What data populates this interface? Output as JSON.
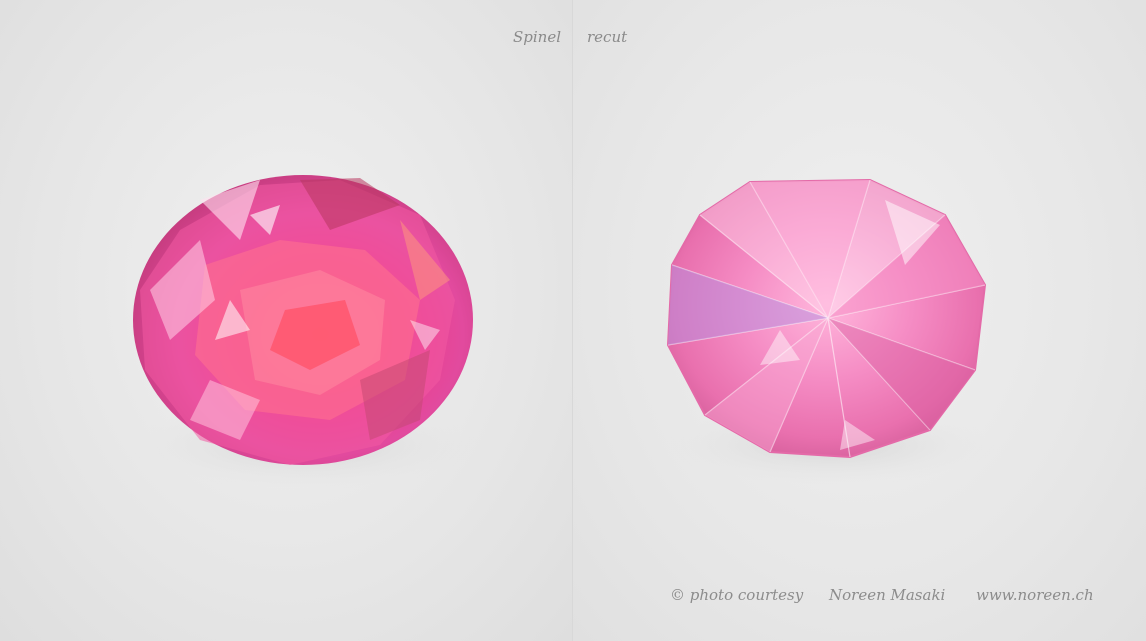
{
  "captions": {
    "left": "Spinel",
    "right": "recut"
  },
  "credit": {
    "copyright": "© photo courtesy",
    "photographer": "Noreen Masaki",
    "website": "www.noreen.ch"
  },
  "colors": {
    "background": "#e9e9e9",
    "gem_original_main": "#e8367a",
    "gem_recut_main": "#f07ab8",
    "text": "#8a8a8a"
  }
}
